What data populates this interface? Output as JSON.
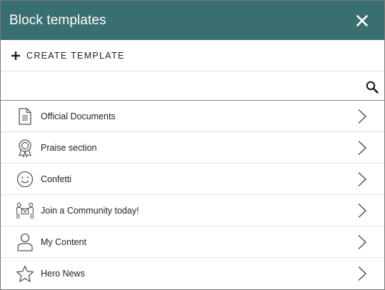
{
  "header": {
    "title": "Block templates",
    "close_icon": "close-icon"
  },
  "toolbar": {
    "create_label": "CREATE TEMPLATE",
    "create_icon": "plus-icon"
  },
  "search": {
    "value": "",
    "placeholder": "",
    "icon": "search-icon"
  },
  "templates": [
    {
      "label": "Official Documents",
      "icon": "document-icon"
    },
    {
      "label": "Praise section",
      "icon": "award-ribbon-icon"
    },
    {
      "label": "Confetti",
      "icon": "smiley-icon"
    },
    {
      "label": "Join a Community today!",
      "icon": "people-group-icon"
    },
    {
      "label": "My Content",
      "icon": "user-icon"
    },
    {
      "label": "Hero News",
      "icon": "star-icon"
    }
  ],
  "colors": {
    "header_bg": "#3a6f71",
    "header_text": "#ffffff",
    "text": "#222222",
    "icon_stroke": "#555555"
  }
}
